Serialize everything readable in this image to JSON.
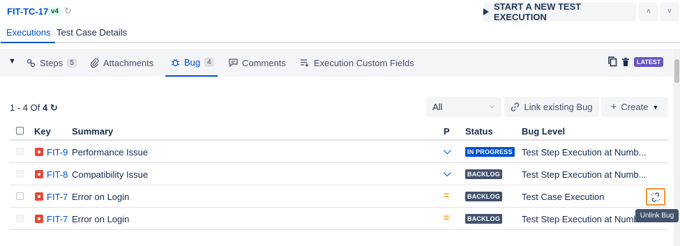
{
  "header": {
    "test_case_key": "FIT-TC-17",
    "version": "v4",
    "start_button": "START A NEW TEST EXECUTION"
  },
  "main_tabs": [
    {
      "label": "Executions",
      "active": true
    },
    {
      "label": "Test Case Details",
      "active": false
    }
  ],
  "sub_tabs": [
    {
      "label": "Steps",
      "count": "5",
      "icon": "steps-icon"
    },
    {
      "label": "Attachments",
      "count": "",
      "icon": "paperclip-icon"
    },
    {
      "label": "Bug",
      "count": "4",
      "icon": "bug-icon",
      "active": true
    },
    {
      "label": "Comments",
      "count": "",
      "icon": "comment-icon"
    },
    {
      "label": "Execution Custom Fields",
      "count": "",
      "icon": "custom-fields-icon"
    }
  ],
  "latest_badge": "LATEST",
  "paging": {
    "range": "1 - 4",
    "of": "Of",
    "total": "4"
  },
  "filter": {
    "selected": "All"
  },
  "actions": {
    "link_existing": "Link existing Bug",
    "create": "Create"
  },
  "table": {
    "headers": {
      "key": "Key",
      "summary": "Summary",
      "priority": "P",
      "status": "Status",
      "bug_level": "Bug Level"
    },
    "rows": [
      {
        "key": "FIT-9",
        "summary": "Performance Issue",
        "priority": "low",
        "status": "IN PROGRESS",
        "bug_level": "Test Step Execution at Numb..."
      },
      {
        "key": "FIT-8",
        "summary": "Compatibility Issue",
        "priority": "low",
        "status": "BACKLOG",
        "bug_level": "Test Step Execution at Numb..."
      },
      {
        "key": "FIT-7",
        "summary": "Error on Login",
        "priority": "medium",
        "status": "BACKLOG",
        "bug_level": "Test Case Execution"
      },
      {
        "key": "FIT-7",
        "summary": "Error on Login",
        "priority": "medium",
        "status": "BACKLOG",
        "bug_level": "Test Step Execution at Numb..."
      }
    ]
  },
  "tooltip": "Unlink Bug",
  "colors": {
    "accent": "#0052cc",
    "bug": "#e5493a",
    "highlight": "#f79232",
    "latest": "#6554c0"
  }
}
